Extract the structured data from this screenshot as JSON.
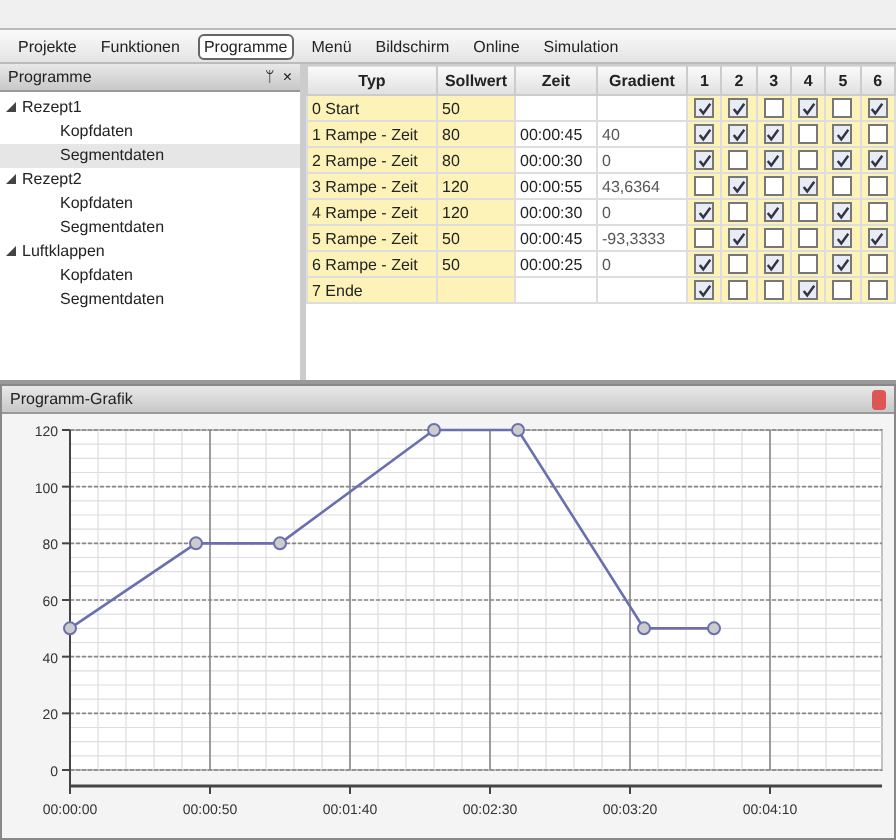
{
  "menu": [
    {
      "label": "Projekte",
      "selected": false
    },
    {
      "label": "Funktionen",
      "selected": false
    },
    {
      "label": "Programme",
      "selected": true
    },
    {
      "label": "Menü",
      "selected": false
    },
    {
      "label": "Bildschirm",
      "selected": false
    },
    {
      "label": "Online",
      "selected": false
    },
    {
      "label": "Simulation",
      "selected": false
    }
  ],
  "sidebar": {
    "title": "Programme",
    "pin": "ᛘ",
    "close": "×",
    "items": [
      {
        "label": "Rezept1",
        "expanded": true,
        "children": [
          {
            "label": "Kopfdaten",
            "selected": false
          },
          {
            "label": "Segmentdaten",
            "selected": true
          }
        ]
      },
      {
        "label": "Rezept2",
        "expanded": true,
        "children": [
          {
            "label": "Kopfdaten",
            "selected": false
          },
          {
            "label": "Segmentdaten",
            "selected": false
          }
        ]
      },
      {
        "label": "Luftklappen",
        "expanded": true,
        "children": [
          {
            "label": "Kopfdaten",
            "selected": false
          },
          {
            "label": "Segmentdaten",
            "selected": false
          }
        ]
      }
    ]
  },
  "table": {
    "columns": [
      "Typ",
      "Sollwert",
      "Zeit",
      "Gradient",
      "1",
      "2",
      "3",
      "4",
      "5",
      "6"
    ],
    "rows": [
      {
        "typ": "0 Start",
        "sollwert": "50",
        "zeit": "",
        "gradient": "",
        "checks": [
          true,
          true,
          false,
          true,
          false,
          true
        ]
      },
      {
        "typ": "1 Rampe - Zeit",
        "sollwert": "80",
        "zeit": "00:00:45",
        "gradient": "40",
        "checks": [
          true,
          true,
          true,
          false,
          true,
          false
        ]
      },
      {
        "typ": "2 Rampe - Zeit",
        "sollwert": "80",
        "zeit": "00:00:30",
        "gradient": "0",
        "checks": [
          true,
          false,
          true,
          false,
          true,
          true
        ]
      },
      {
        "typ": "3 Rampe - Zeit",
        "sollwert": "120",
        "zeit": "00:00:55",
        "gradient": "43,6364",
        "checks": [
          false,
          true,
          false,
          true,
          false,
          false
        ]
      },
      {
        "typ": "4 Rampe - Zeit",
        "sollwert": "120",
        "zeit": "00:00:30",
        "gradient": "0",
        "checks": [
          true,
          false,
          true,
          false,
          true,
          false
        ]
      },
      {
        "typ": "5 Rampe - Zeit",
        "sollwert": "50",
        "zeit": "00:00:45",
        "gradient": "-93,3333",
        "checks": [
          false,
          true,
          false,
          false,
          true,
          true
        ]
      },
      {
        "typ": "6 Rampe - Zeit",
        "sollwert": "50",
        "zeit": "00:00:25",
        "gradient": "0",
        "checks": [
          true,
          false,
          true,
          false,
          true,
          false
        ]
      },
      {
        "typ": "7 Ende",
        "sollwert": "",
        "zeit": "",
        "gradient": "",
        "checks": [
          true,
          false,
          false,
          true,
          false,
          false
        ]
      }
    ]
  },
  "graph": {
    "title": "Programm-Grafik",
    "chart_data": {
      "type": "line",
      "x": [
        0,
        45,
        75,
        130,
        160,
        205,
        230
      ],
      "grid": true,
      "series": [
        {
          "color": "#6a6fb0",
          "marker": true,
          "values": [
            50,
            80,
            80,
            120,
            120,
            50,
            50
          ]
        }
      ],
      "xlim": [
        0,
        290
      ],
      "ylim": [
        0,
        120
      ],
      "xticks": [
        {
          "value": 0,
          "label": "00:00:00"
        },
        {
          "value": 50,
          "label": "00:00:50"
        },
        {
          "value": 100,
          "label": "00:01:40"
        },
        {
          "value": 150,
          "label": "00:02:30"
        },
        {
          "value": 200,
          "label": "00:03:20"
        },
        {
          "value": 250,
          "label": "00:04:10"
        }
      ],
      "yticks": [
        0,
        20,
        40,
        60,
        80,
        100,
        120
      ]
    }
  }
}
